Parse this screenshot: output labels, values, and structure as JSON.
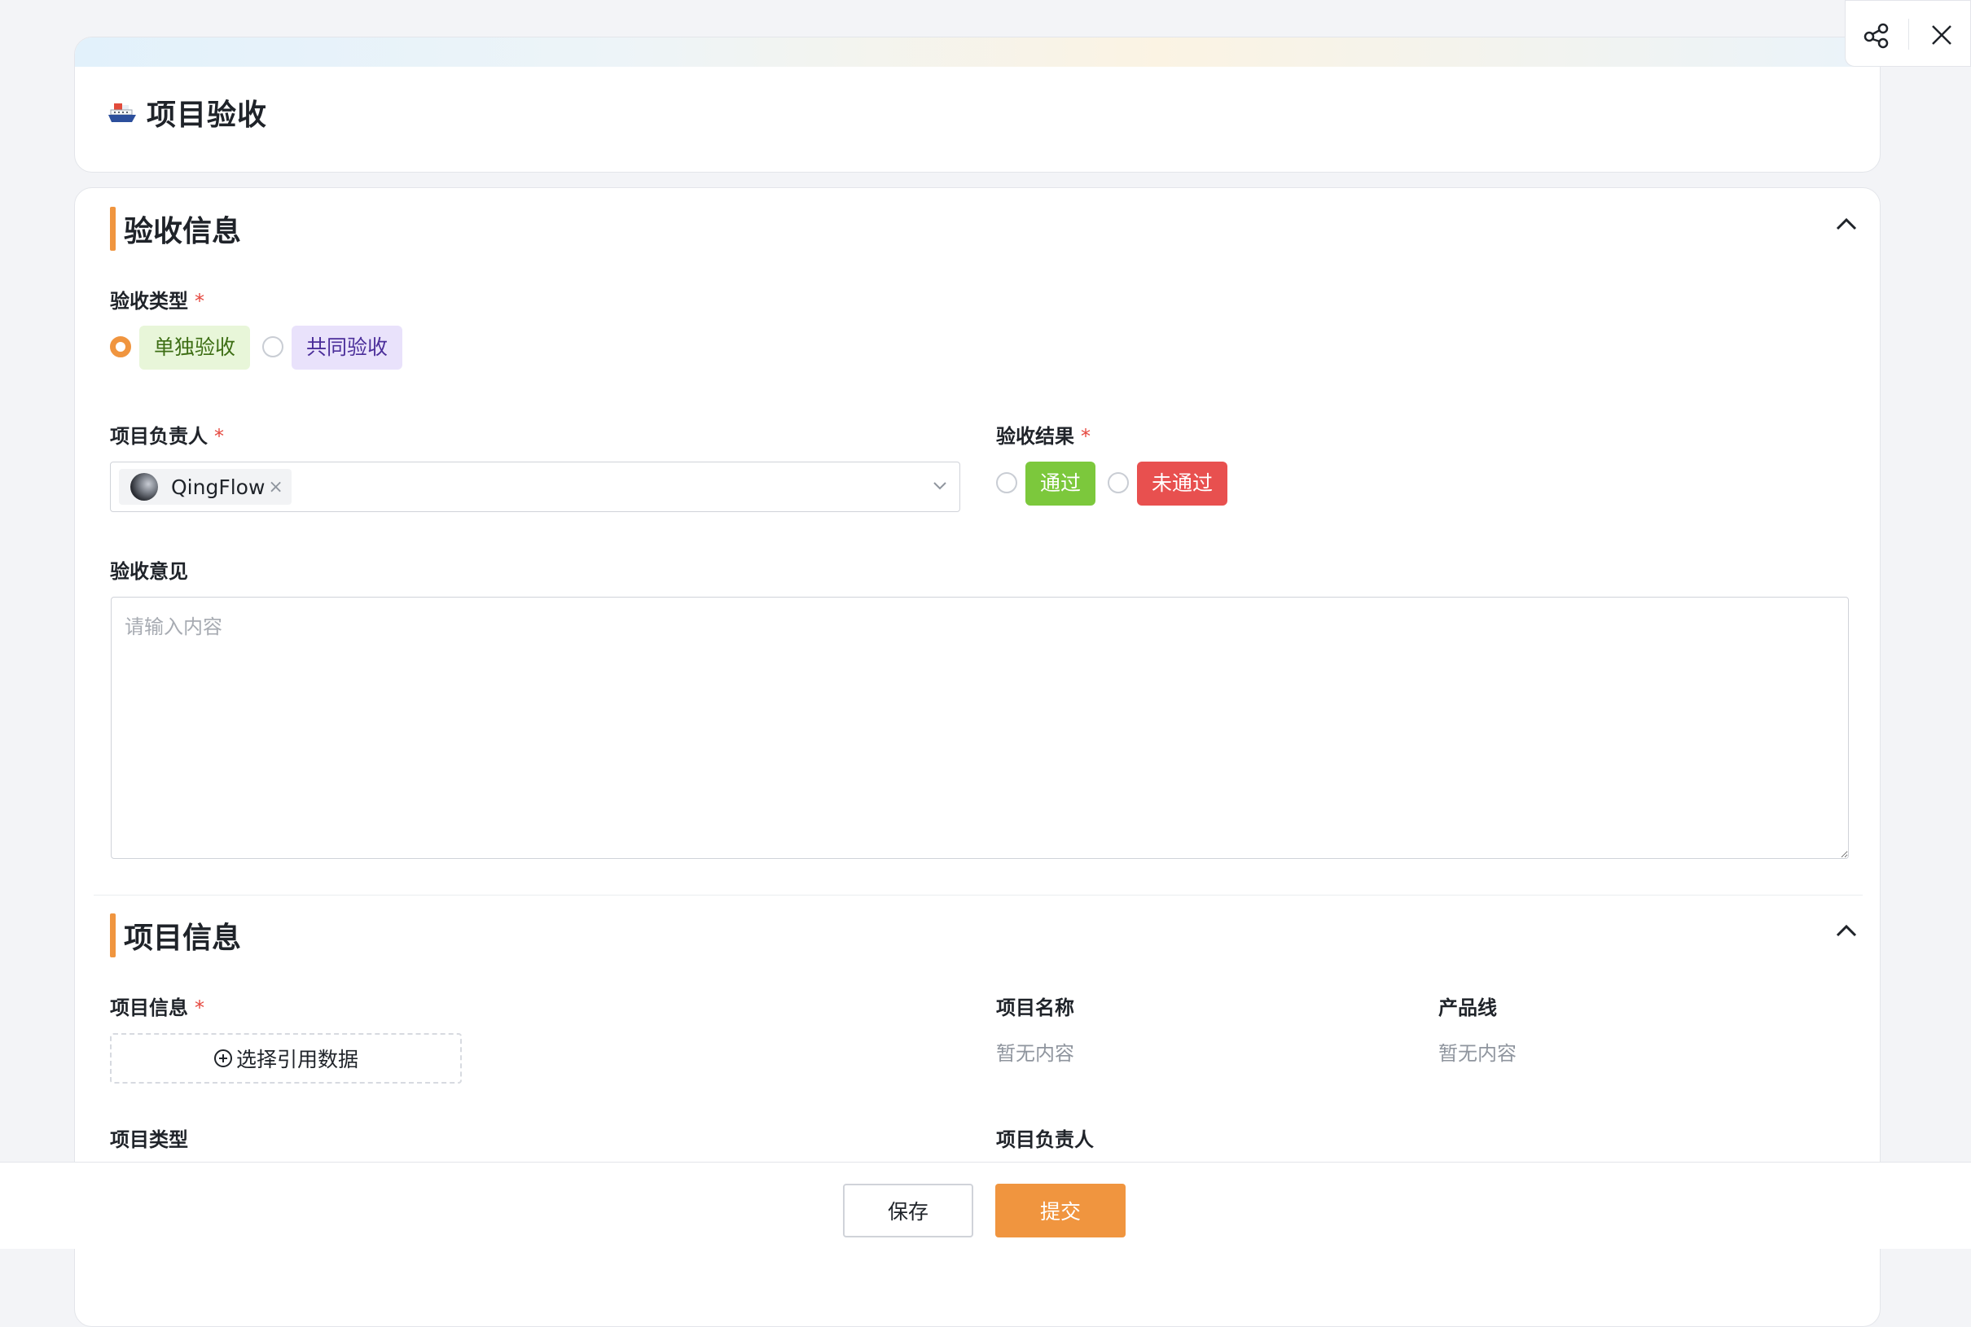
{
  "app": {
    "icon": "ship-icon",
    "title": "项目验收"
  },
  "toolbar": {
    "share_icon": "share-icon",
    "close_icon": "close-icon"
  },
  "sections": {
    "acceptance": {
      "title": "验收信息",
      "type_field": {
        "label": "验收类型",
        "required": "*",
        "options": [
          {
            "label": "单独验收",
            "selected": true,
            "bg": "#e8f6d9",
            "color": "#3d6e14"
          },
          {
            "label": "共同验收",
            "selected": false,
            "bg": "#e9e2fb",
            "color": "#4b2e9a"
          }
        ]
      },
      "owner_field": {
        "label": "项目负责人",
        "required": "*",
        "value": "QingFlow",
        "remove": "×"
      },
      "result_field": {
        "label": "验收结果",
        "required": "*",
        "options": [
          {
            "label": "通过",
            "selected": false,
            "bg": "#7cc83c",
            "color": "#ffffff"
          },
          {
            "label": "未通过",
            "selected": false,
            "bg": "#e8504f",
            "color": "#ffffff"
          }
        ]
      },
      "opinion_field": {
        "label": "验收意见",
        "placeholder": "请输入内容"
      }
    },
    "project": {
      "title": "项目信息",
      "info_field": {
        "label": "项目信息",
        "required": "*",
        "button": "选择引用数据"
      },
      "name_field": {
        "label": "项目名称",
        "value": "暂无内容"
      },
      "product_field": {
        "label": "产品线",
        "value": "暂无内容"
      },
      "type_field": {
        "label": "项目类型"
      },
      "owner_field": {
        "label": "项目负责人"
      }
    }
  },
  "footer": {
    "save": "保存",
    "submit": "提交"
  },
  "colors": {
    "accent": "#f0953f",
    "required": "#e5483f"
  }
}
